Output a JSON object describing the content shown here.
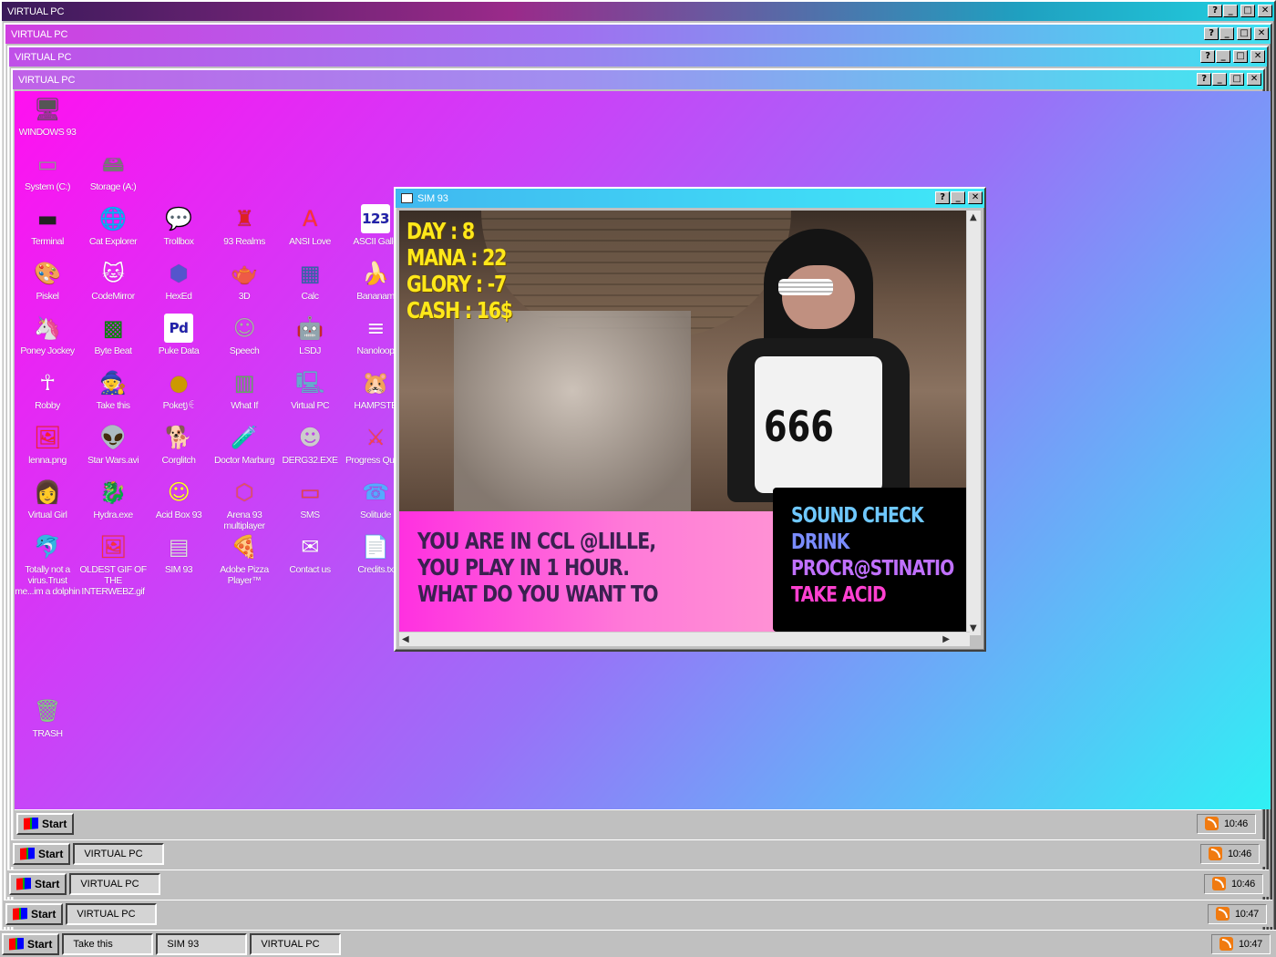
{
  "windows": [
    {
      "title": "VIRTUAL PC"
    },
    {
      "title": "VIRTUAL PC"
    },
    {
      "title": "VIRTUAL PC"
    },
    {
      "title": "VIRTUAL PC"
    }
  ],
  "title_buttons": {
    "help": "?",
    "min": "_",
    "max": "□",
    "close": "✕"
  },
  "icons": [
    {
      "label": "WINDOWS 93",
      "glyph": "🖥"
    },
    {
      "label": "System (C:)",
      "glyph": "▭"
    },
    {
      "label": "Storage (A:)",
      "glyph": "🖴"
    },
    {
      "label": "Terminal",
      "glyph": "▬"
    },
    {
      "label": "Cat Explorer",
      "glyph": "🌐"
    },
    {
      "label": "Trollbox",
      "glyph": "💬"
    },
    {
      "label": "93 Realms",
      "glyph": "♜"
    },
    {
      "label": "ANSI Love",
      "glyph": "A"
    },
    {
      "label": "ASCII Galle",
      "glyph": "123"
    },
    {
      "label": "Piskel",
      "glyph": "🎨"
    },
    {
      "label": "CodeMirror",
      "glyph": "🐱"
    },
    {
      "label": "HexEd",
      "glyph": "⬢"
    },
    {
      "label": "3D",
      "glyph": "🫖"
    },
    {
      "label": "Calc",
      "glyph": "▦"
    },
    {
      "label": "Bananam",
      "glyph": "🍌"
    },
    {
      "label": "Poney Jockey",
      "glyph": "🦄"
    },
    {
      "label": "Byte Beat",
      "glyph": "▩"
    },
    {
      "label": "Puke Data",
      "glyph": "Pd"
    },
    {
      "label": "Speech",
      "glyph": "☺"
    },
    {
      "label": "LSDJ",
      "glyph": "🤖"
    },
    {
      "label": "Nanoloop",
      "glyph": "≡"
    },
    {
      "label": "Robby",
      "glyph": "☥"
    },
    {
      "label": "Take this",
      "glyph": "🧙"
    },
    {
      "label": "Pokeṭ꠸ꑀ",
      "glyph": "●"
    },
    {
      "label": "What If",
      "glyph": "▥"
    },
    {
      "label": "Virtual PC",
      "glyph": "🖳"
    },
    {
      "label": "HAMPSTE",
      "glyph": "🐹"
    },
    {
      "label": "lenna.png",
      "glyph": "🖼"
    },
    {
      "label": "Star Wars.avi",
      "glyph": "👽"
    },
    {
      "label": "Corglitch",
      "glyph": "🐕"
    },
    {
      "label": "Doctor Marburg",
      "glyph": "🧪"
    },
    {
      "label": "DERG32.EXE",
      "glyph": "☻"
    },
    {
      "label": "Progress Quest",
      "glyph": "⚔"
    },
    {
      "label": "Virtual Girl",
      "glyph": "👩"
    },
    {
      "label": "Hydra.exe",
      "glyph": "🐉"
    },
    {
      "label": "Acid Box 93",
      "glyph": "☺"
    },
    {
      "label": "Arena 93 multiplayer",
      "glyph": "⬡"
    },
    {
      "label": "SMS",
      "glyph": "▭"
    },
    {
      "label": "Solitude",
      "glyph": "☎"
    },
    {
      "label": "Totally not a virus.Trust me...im a dolphin",
      "glyph": "🐬"
    },
    {
      "label": "OLDEST GIF OF THE INTERWEBZ.gif",
      "glyph": "🖼"
    },
    {
      "label": "SIM 93",
      "glyph": "▤"
    },
    {
      "label": "Adobe Pizza Player™",
      "glyph": "🍕"
    },
    {
      "label": "Contact us",
      "glyph": "✉"
    },
    {
      "label": "Credits.tx",
      "glyph": "📄"
    },
    {
      "label": "TRASH",
      "glyph": "🗑"
    }
  ],
  "sim": {
    "title": "SIM 93",
    "stats": [
      "DAY : 8",
      "MANA : 22",
      "GLORY : -7",
      "CASH : 16$"
    ],
    "message": [
      "YOU ARE IN CCL @LILLE,",
      "YOU PLAY IN 1 HOUR.",
      "WHAT DO YOU WANT TO"
    ],
    "bib": "666",
    "options": [
      {
        "label": "SOUND CHECK",
        "color": "#6fc8ff"
      },
      {
        "label": "DRINK",
        "color": "#7a8cff"
      },
      {
        "label": "PROCR@STINATIO",
        "color": "#c070ff"
      },
      {
        "label": "TAKE ACID",
        "color": "#ff40d0"
      }
    ]
  },
  "taskbars": [
    {
      "start": "Start",
      "tasks": [],
      "time": "10:46"
    },
    {
      "start": "Start",
      "tasks": [
        "VIRTUAL PC"
      ],
      "time": "10:46"
    },
    {
      "start": "Start",
      "tasks": [
        "VIRTUAL PC"
      ],
      "time": "10:46"
    },
    {
      "start": "Start",
      "tasks": [
        "VIRTUAL PC"
      ],
      "time": "10:47"
    },
    {
      "start": "Start",
      "tasks": [
        "Take this",
        "SIM 93",
        "VIRTUAL PC"
      ],
      "time": "10:47"
    }
  ]
}
